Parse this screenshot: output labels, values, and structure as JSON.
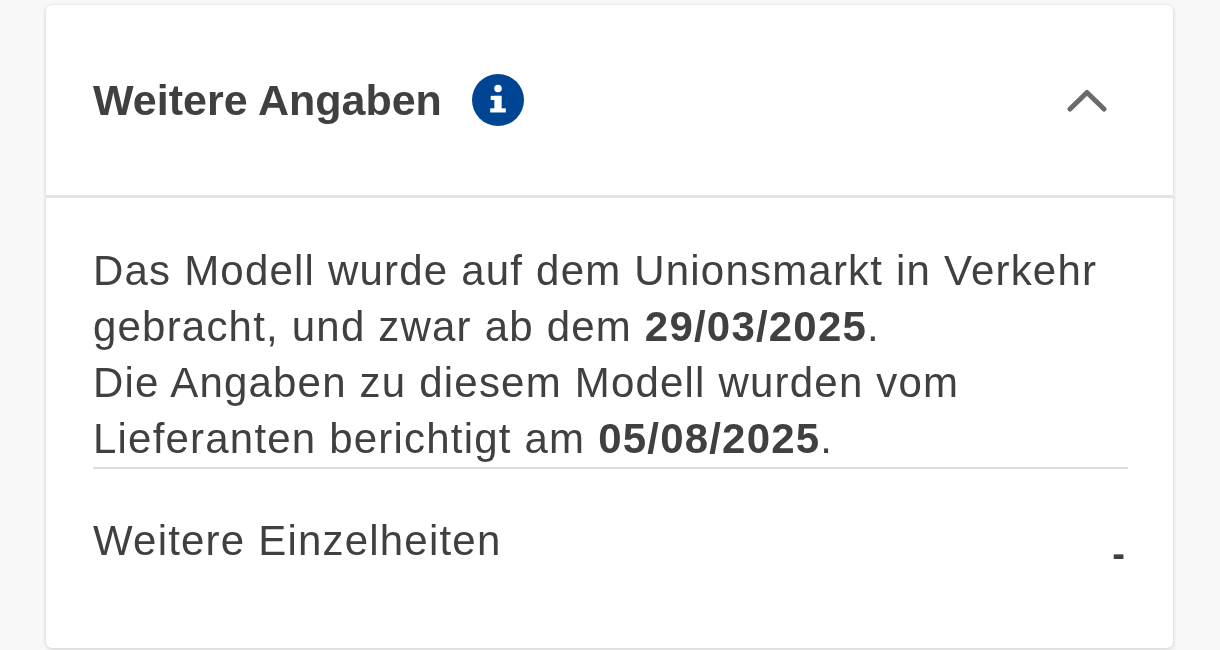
{
  "section": {
    "title": "Weitere Angaben",
    "expanded": true,
    "paragraphs": [
      "Das Modell wurde auf dem Unionsmarkt in Verkehr gebracht, und zwar ab dem **29/03/2025**.",
      "Die Angaben zu diesem Modell wurden vom Lieferanten berichtigt am **05/08/2025**."
    ],
    "details": [
      {
        "label": "Weitere Einzelheiten",
        "value": "-"
      }
    ]
  }
}
